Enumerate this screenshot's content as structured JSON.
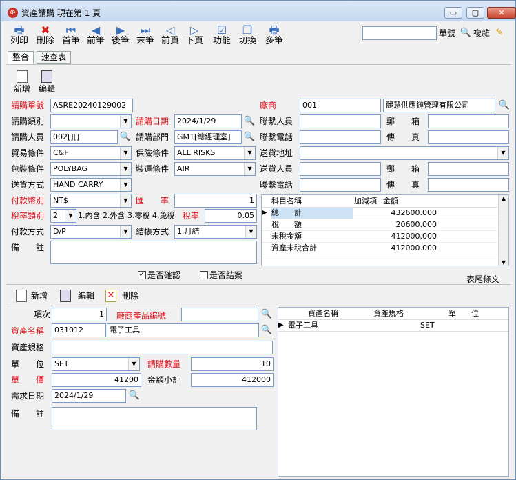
{
  "window": {
    "title": "資產請購  現在第 1 頁",
    "logo_glyph": "⊕"
  },
  "window_controls": {
    "min": "▭",
    "max": "▢",
    "close": "✕"
  },
  "toolbar": [
    {
      "label": "列印",
      "icon": "printer-icon",
      "glyph": "🖶"
    },
    {
      "label": "刪除",
      "icon": "delete-icon",
      "glyph": "✖"
    },
    {
      "label": "首筆",
      "icon": "first-record-icon",
      "glyph": "⏮"
    },
    {
      "label": "前筆",
      "icon": "prev-record-icon",
      "glyph": "◀"
    },
    {
      "label": "後筆",
      "icon": "next-record-icon",
      "glyph": "▶"
    },
    {
      "label": "末筆",
      "icon": "last-record-icon",
      "glyph": "⏭"
    },
    {
      "label": "前頁",
      "icon": "prev-page-icon",
      "glyph": "◁"
    },
    {
      "label": "下頁",
      "icon": "next-page-icon",
      "glyph": "▷"
    },
    {
      "label": "功能",
      "icon": "function-icon",
      "glyph": "☑"
    },
    {
      "label": "切換",
      "icon": "switch-icon",
      "glyph": "❐"
    },
    {
      "label": "多筆",
      "icon": "multi-record-icon",
      "glyph": "🖶"
    }
  ],
  "search": {
    "value": "",
    "label": "單號",
    "copy_label": "複雜"
  },
  "tabs": [
    {
      "label": "整合"
    },
    {
      "label": "速查表"
    }
  ],
  "header_actions": {
    "new": "新增",
    "edit": "編輯"
  },
  "form": {
    "order_no": {
      "label": "請購單號",
      "value": "ASRE20240129002"
    },
    "order_type": {
      "label": "請購類別",
      "value": ""
    },
    "requester": {
      "label": "請購人員",
      "value": "002[][]"
    },
    "trade_terms": {
      "label": "貿易條件",
      "value": "C&F"
    },
    "packing": {
      "label": "包裝條件",
      "value": "POLYBAG"
    },
    "ship_method": {
      "label": "送貨方式",
      "value": "HAND CARRY"
    },
    "currency": {
      "label": "付款幣別",
      "value": "NT$"
    },
    "tax_type": {
      "label": "稅率類別",
      "value": "2",
      "hint": "1.內含 2.外含 3.零稅 4.免稅"
    },
    "payment": {
      "label": "付款方式",
      "value": "D/P"
    },
    "remark": {
      "label": "備　　註",
      "value": ""
    },
    "order_date": {
      "label": "請購日期",
      "value": "2024/1/29"
    },
    "dept": {
      "label": "請購部門",
      "value": "GM1[總經理室]"
    },
    "insurance": {
      "label": "保險條件",
      "value": "ALL RISKS"
    },
    "shipping": {
      "label": "裝運條件",
      "value": "AIR"
    },
    "rate": {
      "label": "匯　　率",
      "value": "1"
    },
    "tax_rate": {
      "label": "稅率",
      "value": "0.05"
    },
    "settle": {
      "label": "結帳方式",
      "value": "1.月結"
    },
    "vendor": {
      "label": "廠商",
      "code": "001",
      "name": "麗慧供應鏈管理有限公司"
    },
    "contact": {
      "label": "聯繫人員",
      "value": ""
    },
    "contact_phone": {
      "label": "聯繫電話",
      "value": ""
    },
    "delivery_addr": {
      "label": "送貨地址",
      "value": ""
    },
    "delivery_person": {
      "label": "送貨人員",
      "value": ""
    },
    "contact_phone2": {
      "label": "聯繫電話",
      "value": ""
    },
    "mailbox": {
      "label": "郵　　箱",
      "value": ""
    },
    "fax": {
      "label": "傳　　真",
      "value": ""
    },
    "mailbox2": {
      "label": "郵　　箱",
      "value": ""
    },
    "fax2": {
      "label": "傳　　真",
      "value": ""
    }
  },
  "summary": {
    "headers": [
      "科目名稱",
      "加減項",
      "金額"
    ],
    "rows": [
      {
        "name": "總　　計",
        "sign": "",
        "amount": "432600.000"
      },
      {
        "name": "稅　　額",
        "sign": "",
        "amount": "20600.000"
      },
      {
        "name": "未稅金額",
        "sign": "",
        "amount": "412000.000"
      },
      {
        "name": "資產未稅合計",
        "sign": "",
        "amount": "412000.000"
      }
    ]
  },
  "checks": {
    "confirmed": "是否確認",
    "closed": "是否結案",
    "footer_text": "表尾條文"
  },
  "detail_actions": {
    "new": "新增",
    "edit": "編輯",
    "delete": "刪除"
  },
  "detail": {
    "seq": {
      "label": "項次",
      "value": "1"
    },
    "vendor_item_no": {
      "label": "廠商產品編號",
      "value": ""
    },
    "asset_name": {
      "label": "資產名稱",
      "code": "031012",
      "name": "電子工具"
    },
    "asset_spec": {
      "label": "資產規格",
      "value": ""
    },
    "unit": {
      "label": "單　　位",
      "value": "SET"
    },
    "qty": {
      "label": "請購數量",
      "value": "10"
    },
    "price": {
      "label": "單　　價",
      "value": "41200"
    },
    "subtotal": {
      "label": "金額小計",
      "value": "412000"
    },
    "need_date": {
      "label": "需求日期",
      "value": "2024/1/29"
    },
    "remark": {
      "label": "備　　註",
      "value": ""
    }
  },
  "detail_grid": {
    "headers": [
      "資產名稱",
      "資產規格",
      "單　　位"
    ],
    "rows": [
      {
        "name": "電子工具",
        "spec": "",
        "unit": "SET"
      }
    ]
  }
}
